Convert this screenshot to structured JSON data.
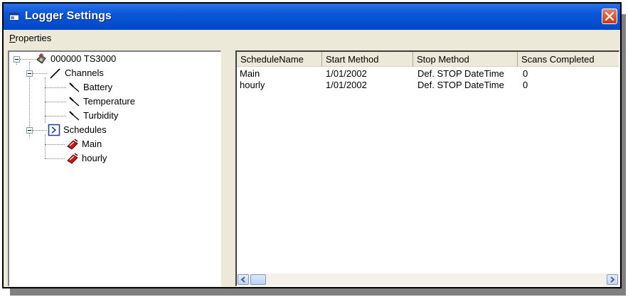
{
  "window": {
    "title": "Logger Settings",
    "title_icon": "window-icon",
    "close_icon": "close-icon",
    "accent_color": "#0a55d8"
  },
  "menubar": {
    "items": [
      {
        "label_accel": "P",
        "label_rest": "roperties"
      }
    ]
  },
  "tree": {
    "root": {
      "label": "000000 TS3000",
      "icon": "logger-device-icon",
      "expanded": true
    },
    "channels": {
      "label": "Channels",
      "icon": "channels-icon",
      "expanded": true,
      "items": [
        {
          "label": "Battery",
          "icon": "probe-icon"
        },
        {
          "label": "Temperature",
          "icon": "probe-icon"
        },
        {
          "label": "Turbidity",
          "icon": "probe-icon"
        }
      ]
    },
    "schedules": {
      "label": "Schedules",
      "icon": "schedule-icon",
      "expanded": true,
      "items": [
        {
          "label": "Main",
          "icon": "schedule-item-icon"
        },
        {
          "label": "hourly",
          "icon": "schedule-item-icon"
        }
      ]
    }
  },
  "list": {
    "columns": [
      "ScheduleName",
      "Start Method",
      "Stop Method",
      "Scans Completed"
    ],
    "rows": [
      [
        "Main",
        "1/01/2002",
        "Def. STOP DateTime",
        "0"
      ],
      [
        "hourly",
        "1/01/2002",
        "Def. STOP DateTime",
        "0"
      ]
    ]
  }
}
